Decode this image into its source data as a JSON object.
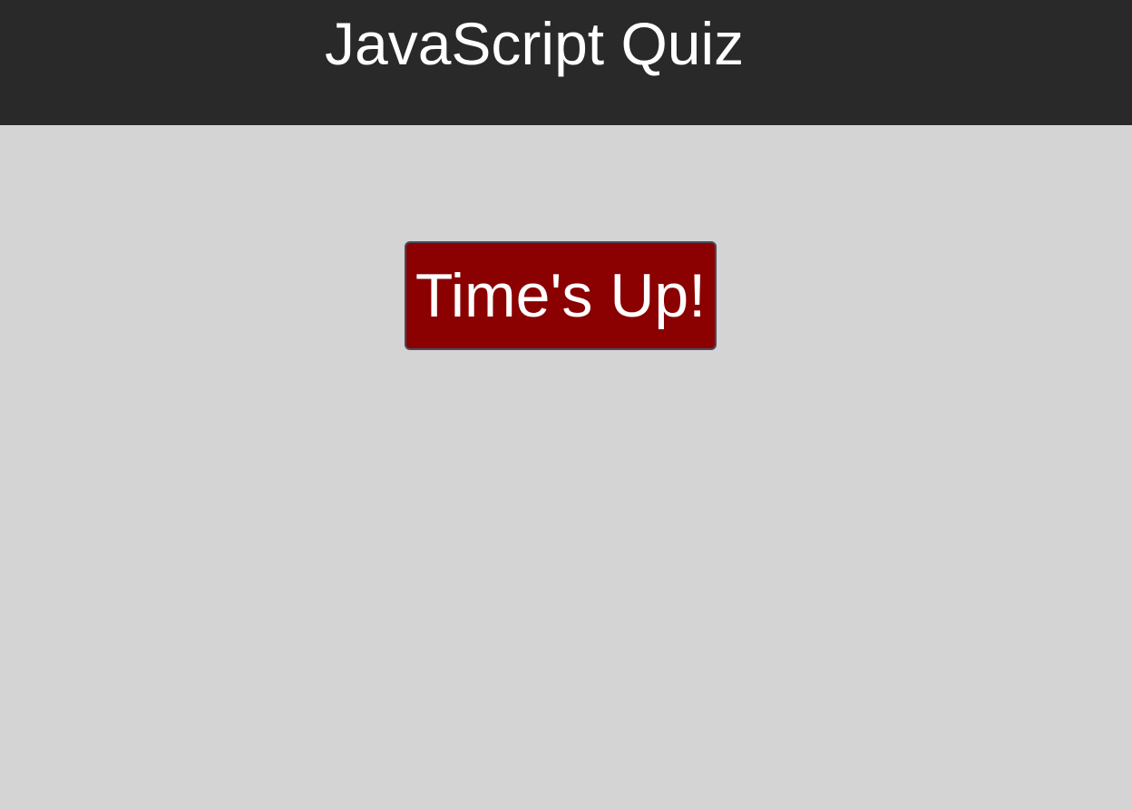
{
  "header": {
    "title": "JavaScript Quiz"
  },
  "main": {
    "status_message": "Time's Up!"
  },
  "colors": {
    "header_background": "#292929",
    "page_background": "#d4d4d4",
    "status_background": "#8b0000",
    "status_text": "#ffffff"
  }
}
